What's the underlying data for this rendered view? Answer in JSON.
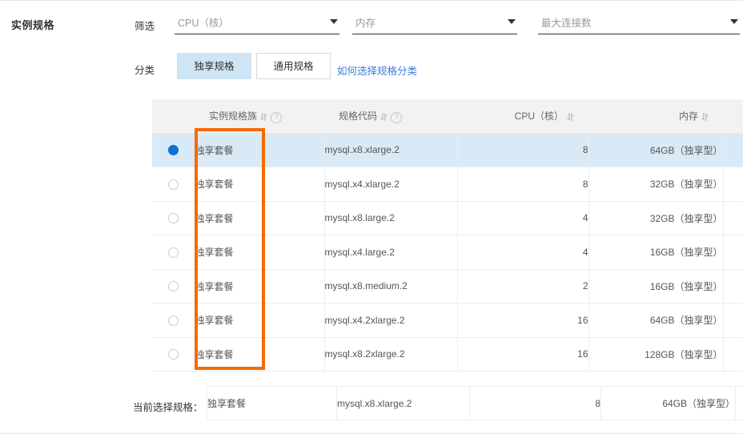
{
  "section": {
    "title": "实例规格"
  },
  "filters": {
    "label": "筛选",
    "selects": [
      {
        "name": "cpu",
        "placeholder": "CPU（核）",
        "value": ""
      },
      {
        "name": "memory",
        "placeholder": "内存",
        "value": ""
      },
      {
        "name": "max_connections",
        "placeholder": "最大连接数",
        "value": ""
      }
    ]
  },
  "category": {
    "label": "分类",
    "tabs": [
      {
        "label": "独享规格",
        "selected": true
      },
      {
        "label": "通用规格",
        "selected": false
      }
    ],
    "help_link": "如何选择规格分类"
  },
  "table": {
    "columns": [
      {
        "key": "radio",
        "label": "",
        "sort": false,
        "help": false,
        "align": "center"
      },
      {
        "key": "family",
        "label": "实例规格族",
        "sort": true,
        "help": true,
        "align": "left"
      },
      {
        "key": "code",
        "label": "规格代码",
        "sort": true,
        "help": true,
        "align": "left"
      },
      {
        "key": "cpu",
        "label": "CPU（核）",
        "sort": true,
        "help": false,
        "align": "right"
      },
      {
        "key": "memory",
        "label": "内存",
        "sort": true,
        "help": false,
        "align": "right"
      },
      {
        "key": "extra",
        "label": "",
        "sort": false,
        "help": false,
        "align": "left"
      }
    ],
    "rows": [
      {
        "selected": true,
        "family": "独享套餐",
        "code": "mysql.x8.xlarge.2",
        "cpu": "8",
        "memory": "64GB（独享型）"
      },
      {
        "selected": false,
        "family": "独享套餐",
        "code": "mysql.x4.xlarge.2",
        "cpu": "8",
        "memory": "32GB（独享型）"
      },
      {
        "selected": false,
        "family": "独享套餐",
        "code": "mysql.x8.large.2",
        "cpu": "4",
        "memory": "32GB（独享型）"
      },
      {
        "selected": false,
        "family": "独享套餐",
        "code": "mysql.x4.large.2",
        "cpu": "4",
        "memory": "16GB（独享型）"
      },
      {
        "selected": false,
        "family": "独享套餐",
        "code": "mysql.x8.medium.2",
        "cpu": "2",
        "memory": "16GB（独享型）"
      },
      {
        "selected": false,
        "family": "独享套餐",
        "code": "mysql.x4.2xlarge.2",
        "cpu": "16",
        "memory": "64GB（独享型）"
      },
      {
        "selected": false,
        "family": "独享套餐",
        "code": "mysql.x8.2xlarge.2",
        "cpu": "16",
        "memory": "128GB（独享型）"
      }
    ]
  },
  "summary": {
    "label": "当前选择规格：",
    "family": "独享套餐",
    "code": "mysql.x8.xlarge.2",
    "cpu": "8",
    "memory": "64GB（独享型）"
  },
  "annotation": {
    "color": "#f56a00",
    "target_column": "实例规格族"
  },
  "colors": {
    "accent_blue": "#0a74d0",
    "selected_row": "#d9e9f6",
    "tab_active": "#cfe5f5",
    "link": "#3b7fd4",
    "annotation_orange": "#f56a00"
  }
}
